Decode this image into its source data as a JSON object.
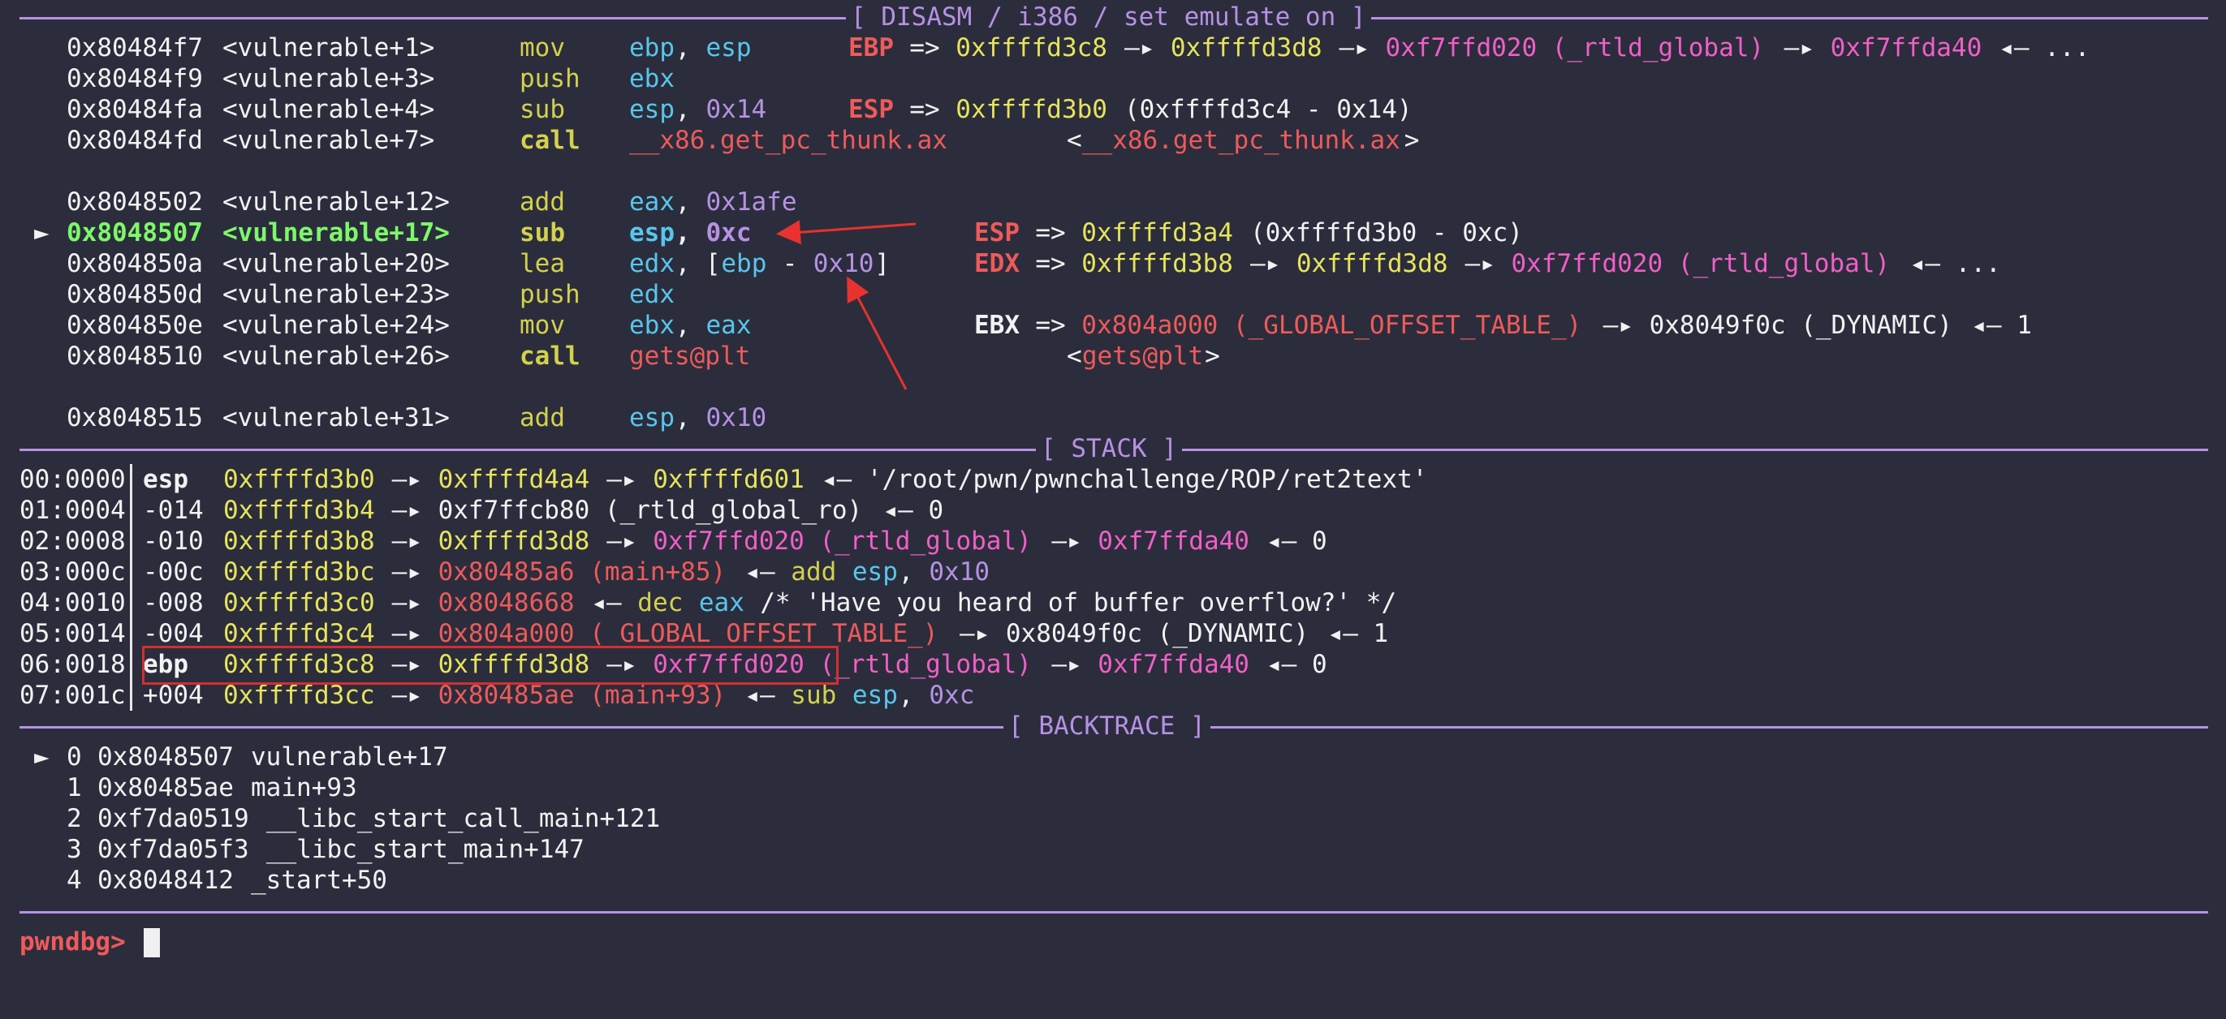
{
  "colors": {
    "bg": "#2b2d3c",
    "white": "#f2f2f2",
    "gray": "#e2e2e2",
    "yellow": "#e7e45c",
    "olive": "#d3d14c",
    "cyan": "#58c6ec",
    "purple": "#b791e4",
    "red": "#ef5a5a",
    "magenta": "#f05fc6",
    "green": "#7ef76a",
    "pink": "#f78fbc",
    "rule": "#b791e4"
  },
  "sections": {
    "disasm": "[ DISASM / i386 / set emulate on ]",
    "stack": "[ STACK ]",
    "backtrace": "[ BACKTRACE ]"
  },
  "disasm": [
    {
      "marker": "",
      "addr": "0x80484f7",
      "sym": "<vulnerable+1>",
      "mnem": "mov",
      "ops": [
        {
          "t": "ebp",
          "c": "cyan"
        },
        {
          "t": ", ",
          "c": "white"
        },
        {
          "t": "esp",
          "c": "cyan"
        }
      ],
      "comment": [
        {
          "t": "EBP",
          "c": "red",
          "b": true
        },
        {
          "t": " => ",
          "c": "white"
        },
        {
          "t": "0xffffd3c8",
          "c": "yellow"
        },
        {
          "t": " —▸ ",
          "c": "white"
        },
        {
          "t": "0xffffd3d8",
          "c": "yellow"
        },
        {
          "t": " —▸ ",
          "c": "white"
        },
        {
          "t": "0xf7ffd020 (_rtld_global)",
          "c": "magenta"
        },
        {
          "t": " —▸ ",
          "c": "white"
        },
        {
          "t": "0xf7ffda40",
          "c": "magenta"
        },
        {
          "t": " ◂— ...",
          "c": "white"
        }
      ]
    },
    {
      "marker": "",
      "addr": "0x80484f9",
      "sym": "<vulnerable+3>",
      "mnem": "push",
      "ops": [
        {
          "t": "ebx",
          "c": "cyan"
        }
      ],
      "comment": []
    },
    {
      "marker": "",
      "addr": "0x80484fa",
      "sym": "<vulnerable+4>",
      "mnem": "sub",
      "ops": [
        {
          "t": "esp",
          "c": "cyan"
        },
        {
          "t": ", ",
          "c": "white"
        },
        {
          "t": "0x14",
          "c": "purple"
        }
      ],
      "comment": [
        {
          "t": "ESP",
          "c": "red",
          "b": true
        },
        {
          "t": " => ",
          "c": "white"
        },
        {
          "t": "0xffffd3b0",
          "c": "yellow"
        },
        {
          "t": " (0xffffd3c4 - 0x14)",
          "c": "white"
        }
      ]
    },
    {
      "marker": "",
      "addr": "0x80484fd",
      "sym": "<vulnerable+7>",
      "mnem": "call",
      "mnemBold": true,
      "ops": [
        {
          "t": "__x86.get_pc_thunk.ax",
          "c": "red"
        }
      ],
      "comment": [
        {
          "t": "<",
          "c": "white"
        },
        {
          "t": "__x86.get_pc_thunk.ax",
          "c": "red"
        },
        {
          "t": ">",
          "c": "white"
        }
      ]
    },
    {
      "blank": true
    },
    {
      "marker": "",
      "addr": "0x8048502",
      "sym": "<vulnerable+12>",
      "mnem": "add",
      "ops": [
        {
          "t": "eax",
          "c": "cyan"
        },
        {
          "t": ", ",
          "c": "white"
        },
        {
          "t": "0x1afe",
          "c": "purple"
        }
      ],
      "comment": []
    },
    {
      "marker": "►",
      "current": true,
      "addr": "0x8048507",
      "sym": "<vulnerable+17>",
      "mnem": "sub",
      "mnemBold": true,
      "ops": [
        {
          "t": "esp",
          "c": "cyan",
          "b": true
        },
        {
          "t": ", ",
          "c": "white",
          "b": true
        },
        {
          "t": "0xc",
          "c": "purple",
          "b": true
        }
      ],
      "comment": [
        {
          "t": "ESP",
          "c": "red",
          "b": true
        },
        {
          "t": " => ",
          "c": "white"
        },
        {
          "t": "0xffffd3a4",
          "c": "yellow"
        },
        {
          "t": " (0xffffd3b0 - 0xc)",
          "c": "white"
        }
      ]
    },
    {
      "marker": "",
      "addr": "0x804850a",
      "sym": "<vulnerable+20>",
      "mnem": "lea",
      "ops": [
        {
          "t": "edx",
          "c": "cyan"
        },
        {
          "t": ", [",
          "c": "white"
        },
        {
          "t": "ebp",
          "c": "cyan"
        },
        {
          "t": " - ",
          "c": "white"
        },
        {
          "t": "0x10",
          "c": "purple"
        },
        {
          "t": "]",
          "c": "white"
        }
      ],
      "comment": [
        {
          "t": "EDX",
          "c": "red",
          "b": true
        },
        {
          "t": " => ",
          "c": "white"
        },
        {
          "t": "0xffffd3b8",
          "c": "yellow"
        },
        {
          "t": " —▸ ",
          "c": "white"
        },
        {
          "t": "0xffffd3d8",
          "c": "yellow"
        },
        {
          "t": " —▸ ",
          "c": "white"
        },
        {
          "t": "0xf7ffd020 (_rtld_global)",
          "c": "magenta"
        },
        {
          "t": " ◂— ...",
          "c": "white"
        }
      ]
    },
    {
      "marker": "",
      "addr": "0x804850d",
      "sym": "<vulnerable+23>",
      "mnem": "push",
      "ops": [
        {
          "t": "edx",
          "c": "cyan"
        }
      ],
      "comment": []
    },
    {
      "marker": "",
      "addr": "0x804850e",
      "sym": "<vulnerable+24>",
      "mnem": "mov",
      "ops": [
        {
          "t": "ebx",
          "c": "cyan"
        },
        {
          "t": ", ",
          "c": "white"
        },
        {
          "t": "eax",
          "c": "cyan"
        }
      ],
      "comment": [
        {
          "t": "EBX",
          "c": "white",
          "b": true
        },
        {
          "t": " => ",
          "c": "white"
        },
        {
          "t": "0x804a000 (_GLOBAL_OFFSET_TABLE_)",
          "c": "red"
        },
        {
          "t": " —▸ ",
          "c": "white"
        },
        {
          "t": "0x8049f0c (_DYNAMIC)",
          "c": "white"
        },
        {
          "t": " ◂— 1",
          "c": "white"
        }
      ]
    },
    {
      "marker": "",
      "addr": "0x8048510",
      "sym": "<vulnerable+26>",
      "mnem": "call",
      "mnemBold": true,
      "ops": [
        {
          "t": "gets@plt",
          "c": "red"
        }
      ],
      "comment": [
        {
          "t": "<",
          "c": "white"
        },
        {
          "t": "gets@plt",
          "c": "red"
        },
        {
          "t": ">",
          "c": "white"
        }
      ]
    },
    {
      "blank": true
    },
    {
      "marker": "",
      "addr": "0x8048515",
      "sym": "<vulnerable+31>",
      "mnem": "add",
      "ops": [
        {
          "t": "esp",
          "c": "cyan"
        },
        {
          "t": ", ",
          "c": "white"
        },
        {
          "t": "0x10",
          "c": "purple"
        }
      ],
      "comment": []
    }
  ],
  "stack": [
    {
      "idx": "00:0000",
      "reg": "esp",
      "regBold": true,
      "chain": [
        {
          "t": "0xffffd3b0",
          "c": "yellow"
        },
        {
          "t": " —▸ ",
          "c": "white"
        },
        {
          "t": "0xffffd4a4",
          "c": "yellow"
        },
        {
          "t": " —▸ ",
          "c": "white"
        },
        {
          "t": "0xffffd601",
          "c": "yellow"
        },
        {
          "t": " ◂— '/root/pwn/pwnchallenge/ROP/ret2text'",
          "c": "white"
        }
      ]
    },
    {
      "idx": "01:0004",
      "reg": "-014",
      "chain": [
        {
          "t": "0xffffd3b4",
          "c": "yellow"
        },
        {
          "t": " —▸ ",
          "c": "white"
        },
        {
          "t": "0xf7ffcb80 (_rtld_global_ro)",
          "c": "white"
        },
        {
          "t": " ◂— 0",
          "c": "white"
        }
      ]
    },
    {
      "idx": "02:0008",
      "reg": "-010",
      "chain": [
        {
          "t": "0xffffd3b8",
          "c": "yellow"
        },
        {
          "t": " —▸ ",
          "c": "white"
        },
        {
          "t": "0xffffd3d8",
          "c": "yellow"
        },
        {
          "t": " —▸ ",
          "c": "white"
        },
        {
          "t": "0xf7ffd020 (_rtld_global)",
          "c": "magenta"
        },
        {
          "t": " —▸ ",
          "c": "white"
        },
        {
          "t": "0xf7ffda40",
          "c": "magenta"
        },
        {
          "t": " ◂— 0",
          "c": "white"
        }
      ]
    },
    {
      "idx": "03:000c",
      "reg": "-00c",
      "chain": [
        {
          "t": "0xffffd3bc",
          "c": "yellow"
        },
        {
          "t": " —▸ ",
          "c": "white"
        },
        {
          "t": "0x80485a6 (main+85)",
          "c": "red"
        },
        {
          "t": " ◂— ",
          "c": "white"
        },
        {
          "t": "add",
          "c": "olive"
        },
        {
          "t": " ",
          "c": "white"
        },
        {
          "t": "esp",
          "c": "cyan"
        },
        {
          "t": ", ",
          "c": "white"
        },
        {
          "t": "0x10",
          "c": "purple"
        }
      ]
    },
    {
      "idx": "04:0010",
      "reg": "-008",
      "chain": [
        {
          "t": "0xffffd3c0",
          "c": "yellow"
        },
        {
          "t": " —▸ ",
          "c": "white"
        },
        {
          "t": "0x8048668",
          "c": "red"
        },
        {
          "t": " ◂— ",
          "c": "white"
        },
        {
          "t": "dec",
          "c": "olive"
        },
        {
          "t": " ",
          "c": "white"
        },
        {
          "t": "eax",
          "c": "cyan"
        },
        {
          "t": " /* 'Have you heard of buffer overflow?' */",
          "c": "white"
        }
      ]
    },
    {
      "idx": "05:0014",
      "reg": "-004",
      "chain": [
        {
          "t": "0xffffd3c4",
          "c": "yellow"
        },
        {
          "t": " —▸ ",
          "c": "white"
        },
        {
          "t": "0x804a000 (_GLOBAL_OFFSET_TABLE_)",
          "c": "red"
        },
        {
          "t": " —▸ ",
          "c": "white"
        },
        {
          "t": "0x8049f0c (_DYNAMIC)",
          "c": "white"
        },
        {
          "t": " ◂— 1",
          "c": "white"
        }
      ]
    },
    {
      "idx": "06:0018",
      "reg": "ebp",
      "regBold": true,
      "chain": [
        {
          "t": "0xffffd3c8",
          "c": "yellow"
        },
        {
          "t": " —▸ ",
          "c": "white"
        },
        {
          "t": "0xffffd3d8",
          "c": "yellow"
        },
        {
          "t": " —▸ ",
          "c": "white"
        },
        {
          "t": "0xf7ffd020 (_rtld_global)",
          "c": "magenta"
        },
        {
          "t": " —▸ ",
          "c": "white"
        },
        {
          "t": "0xf7ffda40",
          "c": "magenta"
        },
        {
          "t": " ◂— 0",
          "c": "white"
        }
      ]
    },
    {
      "idx": "07:001c",
      "reg": "+004",
      "chain": [
        {
          "t": "0xffffd3cc",
          "c": "yellow"
        },
        {
          "t": " —▸ ",
          "c": "white"
        },
        {
          "t": "0x80485ae (main+93)",
          "c": "red"
        },
        {
          "t": " ◂— ",
          "c": "white"
        },
        {
          "t": "sub",
          "c": "olive"
        },
        {
          "t": " ",
          "c": "white"
        },
        {
          "t": "esp",
          "c": "cyan"
        },
        {
          "t": ", ",
          "c": "white"
        },
        {
          "t": "0xc",
          "c": "purple"
        }
      ]
    }
  ],
  "backtrace": [
    {
      "marker": "►",
      "num": "0",
      "addr": "0x8048507",
      "sym": "vulnerable+17"
    },
    {
      "marker": "",
      "num": "1",
      "addr": "0x80485ae",
      "sym": "main+93"
    },
    {
      "marker": "",
      "num": "2",
      "addr": "0xf7da0519",
      "sym": "__libc_start_call_main+121"
    },
    {
      "marker": "",
      "num": "3",
      "addr": "0xf7da05f3",
      "sym": "__libc_start_main+147"
    },
    {
      "marker": "",
      "num": "4",
      "addr": "0x8048412",
      "sym": "_start+50"
    }
  ],
  "prompt": "pwndbg>"
}
